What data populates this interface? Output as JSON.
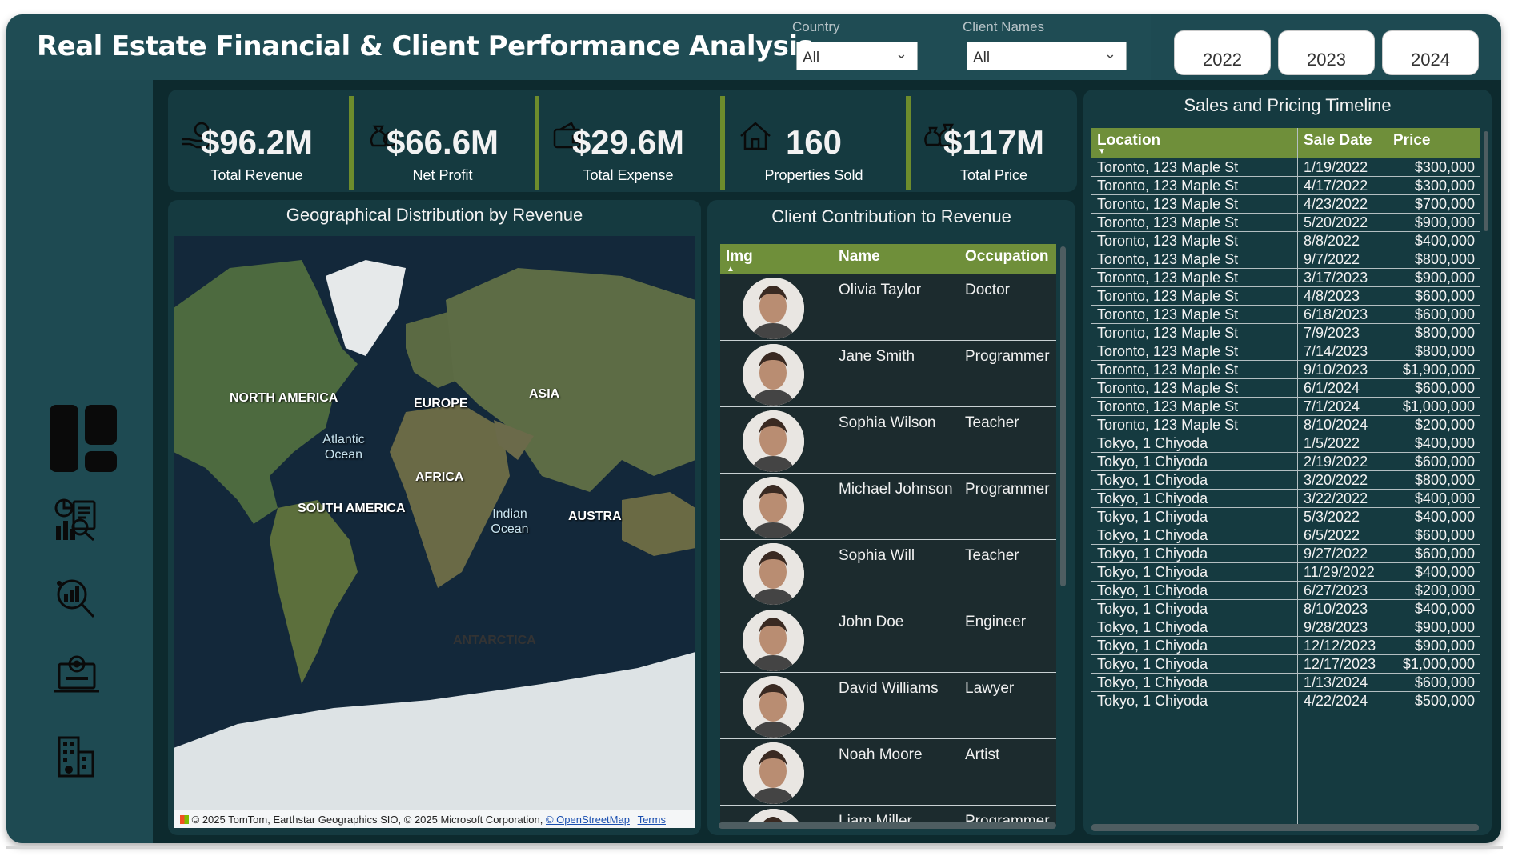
{
  "header": {
    "title": "Real Estate Financial & Client Performance Analysis",
    "country_label": "Country",
    "country_value": "All",
    "client_label": "Client Names",
    "client_value": "All",
    "years": [
      "2022",
      "2023",
      "2024"
    ]
  },
  "sidebar": {
    "icons": [
      "dashboard-icon",
      "analytics-report-icon",
      "search-chart-icon",
      "laptop-analysis-icon",
      "building-finance-icon"
    ]
  },
  "kpis": [
    {
      "value": "$96.2M",
      "label": "Total Revenue",
      "icon": "revenue-hand-icon"
    },
    {
      "value": "$66.6M",
      "label": "Net Profit",
      "icon": "money-bag-icon"
    },
    {
      "value": "$29.6M",
      "label": "Total Expense",
      "icon": "wallet-icon"
    },
    {
      "value": "160",
      "label": "Properties Sold",
      "icon": "house-icon"
    },
    {
      "value": "$117M",
      "label": "Total Price",
      "icon": "price-bags-icon"
    }
  ],
  "map": {
    "title": "Geographical Distribution by Revenue",
    "labels": {
      "north_america": "NORTH AMERICA",
      "europe": "EUROPE",
      "asia": "ASIA",
      "africa": "AFRICA",
      "south_america": "SOUTH AMERICA",
      "australia": "AUSTRA",
      "antarctica": "ANTARCTICA",
      "atlantic": "Atlantic Ocean",
      "indian": "Indian Ocean"
    },
    "attribution": "© 2025 TomTom, Earthstar Geographics SIO, © 2025 Microsoft Corporation,",
    "osm_link": "© OpenStreetMap",
    "terms_link": "Terms"
  },
  "clients": {
    "title": "Client Contribution to Revenue",
    "columns": [
      "Img",
      "Name",
      "Occupation"
    ],
    "rows": [
      {
        "name": "Olivia Taylor",
        "occupation": "Doctor"
      },
      {
        "name": "Jane Smith",
        "occupation": "Programmer"
      },
      {
        "name": "Sophia Wilson",
        "occupation": "Teacher"
      },
      {
        "name": "Michael Johnson",
        "occupation": "Programmer"
      },
      {
        "name": "Sophia Will",
        "occupation": "Teacher"
      },
      {
        "name": "John Doe",
        "occupation": "Engineer"
      },
      {
        "name": "David Williams",
        "occupation": "Lawyer"
      },
      {
        "name": "Noah Moore",
        "occupation": "Artist"
      },
      {
        "name": "Liam Miller",
        "occupation": "Programmer"
      }
    ]
  },
  "sales": {
    "title": "Sales and Pricing Timeline",
    "columns": [
      "Location",
      "Sale Date",
      "Price"
    ],
    "rows": [
      [
        "Toronto, 123 Maple St",
        "1/19/2022",
        "$300,000"
      ],
      [
        "Toronto, 123 Maple St",
        "4/17/2022",
        "$300,000"
      ],
      [
        "Toronto, 123 Maple St",
        "4/23/2022",
        "$700,000"
      ],
      [
        "Toronto, 123 Maple St",
        "5/20/2022",
        "$900,000"
      ],
      [
        "Toronto, 123 Maple St",
        "8/8/2022",
        "$400,000"
      ],
      [
        "Toronto, 123 Maple St",
        "9/7/2022",
        "$800,000"
      ],
      [
        "Toronto, 123 Maple St",
        "3/17/2023",
        "$900,000"
      ],
      [
        "Toronto, 123 Maple St",
        "4/8/2023",
        "$600,000"
      ],
      [
        "Toronto, 123 Maple St",
        "6/18/2023",
        "$600,000"
      ],
      [
        "Toronto, 123 Maple St",
        "7/9/2023",
        "$800,000"
      ],
      [
        "Toronto, 123 Maple St",
        "7/14/2023",
        "$800,000"
      ],
      [
        "Toronto, 123 Maple St",
        "9/10/2023",
        "$1,900,000"
      ],
      [
        "Toronto, 123 Maple St",
        "6/1/2024",
        "$600,000"
      ],
      [
        "Toronto, 123 Maple St",
        "7/1/2024",
        "$1,000,000"
      ],
      [
        "Toronto, 123 Maple St",
        "8/10/2024",
        "$200,000"
      ],
      [
        "Tokyo, 1 Chiyoda",
        "1/5/2022",
        "$400,000"
      ],
      [
        "Tokyo, 1 Chiyoda",
        "2/19/2022",
        "$600,000"
      ],
      [
        "Tokyo, 1 Chiyoda",
        "3/20/2022",
        "$800,000"
      ],
      [
        "Tokyo, 1 Chiyoda",
        "3/22/2022",
        "$400,000"
      ],
      [
        "Tokyo, 1 Chiyoda",
        "5/3/2022",
        "$400,000"
      ],
      [
        "Tokyo, 1 Chiyoda",
        "6/5/2022",
        "$600,000"
      ],
      [
        "Tokyo, 1 Chiyoda",
        "9/27/2022",
        "$600,000"
      ],
      [
        "Tokyo, 1 Chiyoda",
        "11/29/2022",
        "$400,000"
      ],
      [
        "Tokyo, 1 Chiyoda",
        "6/27/2023",
        "$200,000"
      ],
      [
        "Tokyo, 1 Chiyoda",
        "8/10/2023",
        "$400,000"
      ],
      [
        "Tokyo, 1 Chiyoda",
        "9/28/2023",
        "$900,000"
      ],
      [
        "Tokyo, 1 Chiyoda",
        "12/12/2023",
        "$900,000"
      ],
      [
        "Tokyo, 1 Chiyoda",
        "12/17/2023",
        "$1,000,000"
      ],
      [
        "Tokyo, 1 Chiyoda",
        "1/13/2024",
        "$600,000"
      ],
      [
        "Tokyo, 1 Chiyoda",
        "4/22/2024",
        "$500,000"
      ]
    ]
  },
  "colors": {
    "accent_green": "#6f8f3a",
    "frame_teal": "#1e4a52",
    "panel_dark": "#153a40",
    "background_dark": "#0d2a2e"
  }
}
